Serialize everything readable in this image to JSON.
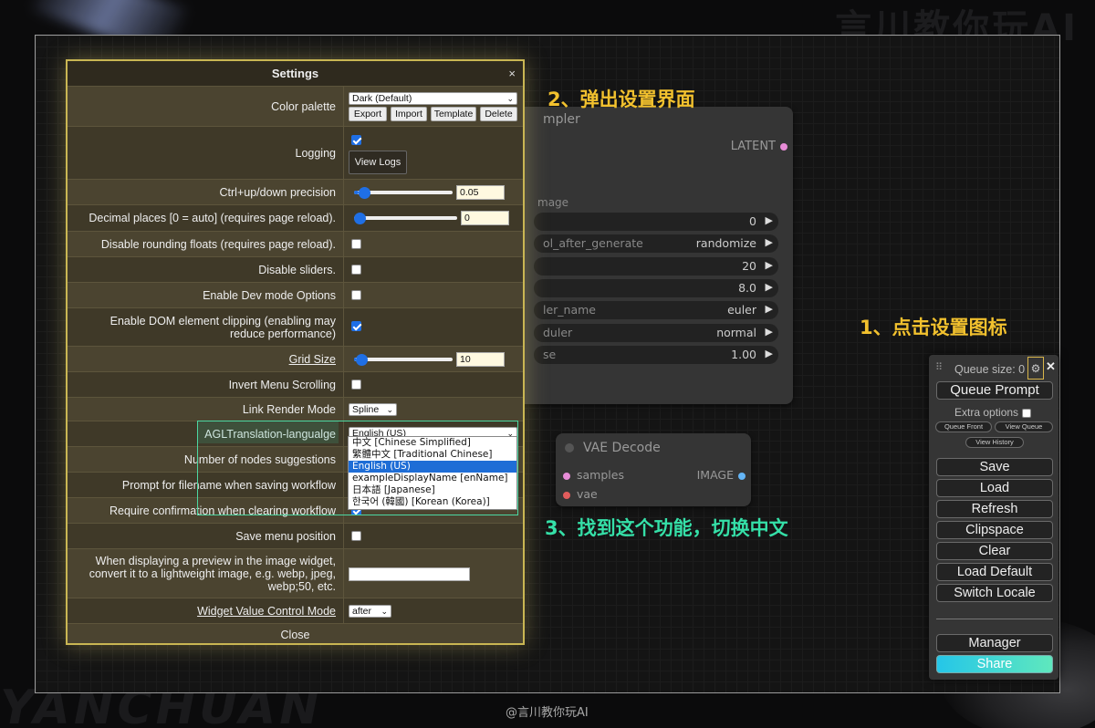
{
  "watermark": {
    "top": "言川教你玩AI",
    "bottom": "YANCHUAN",
    "credit": "@言川教你玩AI"
  },
  "annotations": {
    "step1": "1、点击设置图标",
    "step2": "2、弹出设置界面",
    "step3": "3、找到这个功能，切换中文"
  },
  "ksampler": {
    "title": "mpler",
    "output": "LATENT",
    "image_label": "mage",
    "rows": [
      {
        "key": "",
        "value": "0"
      },
      {
        "key": "ol_after_generate",
        "value": "randomize"
      },
      {
        "key": "",
        "value": "20"
      },
      {
        "key": "",
        "value": "8.0"
      },
      {
        "key": "ler_name",
        "value": "euler"
      },
      {
        "key": "duler",
        "value": "normal"
      },
      {
        "key": "se",
        "value": "1.00"
      }
    ]
  },
  "vae": {
    "title": "VAE Decode",
    "input1": "samples",
    "input2": "vae",
    "output": "IMAGE"
  },
  "settings": {
    "title": "Settings",
    "close_x": "×",
    "color_palette": {
      "label": "Color palette",
      "value": "Dark (Default)",
      "buttons": [
        "Export",
        "Import",
        "Template",
        "Delete"
      ]
    },
    "logging": {
      "label": "Logging",
      "checked": true,
      "button": "View Logs"
    },
    "precision": {
      "label": "Ctrl+up/down precision",
      "value": "0.05",
      "fraction": 0.05
    },
    "decimal": {
      "label": "Decimal places [0 = auto] (requires page reload).",
      "value": "0",
      "fraction": 0.0
    },
    "rounding": {
      "label": "Disable rounding floats (requires page reload).",
      "checked": false
    },
    "sliders": {
      "label": "Disable sliders.",
      "checked": false
    },
    "devmode": {
      "label": "Enable Dev mode Options",
      "checked": false
    },
    "dom_clipping": {
      "label": "Enable DOM element clipping (enabling may reduce performance)",
      "checked": true
    },
    "grid": {
      "label": "Grid Size",
      "value": "10",
      "fraction": 0.02
    },
    "invert_menu": {
      "label": "Invert Menu Scrolling",
      "checked": false
    },
    "link_render": {
      "label": "Link Render Mode",
      "value": "Spline"
    },
    "translation": {
      "label": "AGLTranslation-langualge",
      "value": "English (US)",
      "options": [
        "中文 [Chinese Simplified]",
        "繁體中文 [Traditional Chinese]",
        "English (US)",
        "exampleDisplayName [enName]",
        "日本語 [Japanese]",
        "한국어 (韓國) [Korean (Korea)]"
      ],
      "selected_index": 2
    },
    "node_suggestions": {
      "label": "Number of nodes suggestions"
    },
    "prompt_filename": {
      "label": "Prompt for filename when saving workflow"
    },
    "confirm_clear": {
      "label": "Require confirmation when clearing workflow"
    },
    "save_menu": {
      "label": "Save menu position",
      "checked": false
    },
    "preview": {
      "label": "When displaying a preview in the image widget, convert it to a lightweight image, e.g. webp, jpeg, webp;50, etc.",
      "value": ""
    },
    "widget_mode": {
      "label": "Widget Value Control Mode",
      "value": "after"
    },
    "close_label": "Close"
  },
  "queue": {
    "drag": "⠿",
    "size_label": "Queue size: 0",
    "gear": "⚙",
    "close": "✕",
    "queue_prompt": "Queue Prompt",
    "extra_options": "Extra options",
    "queue_front": "Queue Front",
    "view_queue": "View Queue",
    "view_history": "View History",
    "buttons": [
      "Save",
      "Load",
      "Refresh",
      "Clipspace",
      "Clear",
      "Load Default",
      "Switch Locale"
    ],
    "manager": "Manager",
    "share": "Share"
  }
}
